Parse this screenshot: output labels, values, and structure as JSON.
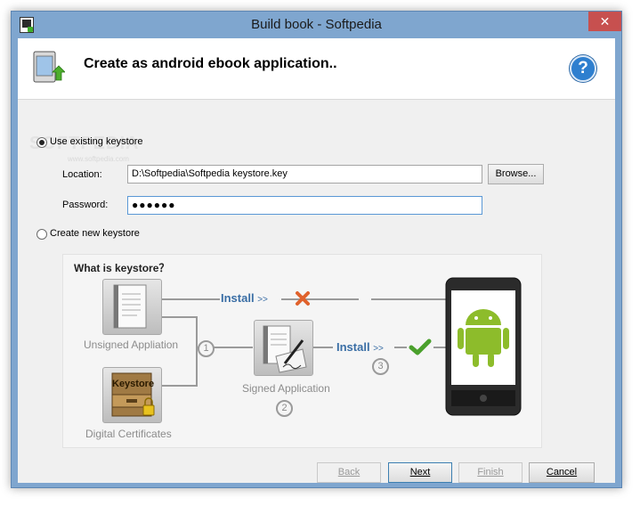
{
  "window": {
    "title": "Build book - Softpedia",
    "close_glyph": "✕"
  },
  "header": {
    "title": "Create as android ebook application..",
    "help_glyph": "?"
  },
  "watermark": {
    "text": "SOFTPEDIA",
    "sub": "www.softpedia.com"
  },
  "keystore": {
    "use_existing_label": "Use existing keystore",
    "create_new_label": "Create new keystore",
    "selected": "use_existing",
    "location_label": "Location:",
    "location_value": "D:\\Softpedia\\Softpedia keystore.key",
    "browse_label": "Browse...",
    "password_label": "Password:",
    "password_value": "●●●●●●"
  },
  "diagram": {
    "title": "What is keystore？",
    "unsigned_label": "Unsigned Appliation",
    "certificates_label": "Digital Certificates",
    "keystore_tag": "Keystore",
    "signed_label": "Signed Application",
    "install_top": "Install",
    "install_bottom": "Install",
    "chevrons": ">>",
    "step1": "1",
    "step2": "2",
    "step3": "3",
    "colors": {
      "cross": "#e0622c",
      "check": "#4aa02c",
      "install": "#3a6ea5",
      "android": "#8dbc2b"
    }
  },
  "footer": {
    "back_label": "Back",
    "next_label": "Next",
    "finish_label": "Finish",
    "cancel_label": "Cancel"
  }
}
